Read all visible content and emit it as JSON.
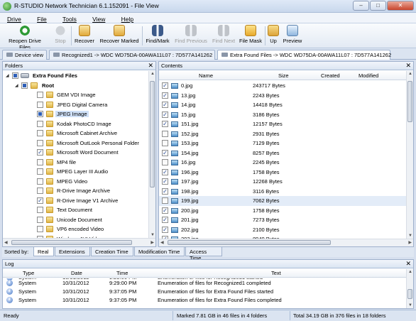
{
  "window": {
    "title": "R-STUDIO Network Technician 6.1.152091 - File View",
    "buttons": {
      "minimize": "–",
      "maximize": "□",
      "close": "✕"
    }
  },
  "menu": [
    {
      "label": "Drive",
      "underline": "D"
    },
    {
      "label": "File",
      "underline": "F"
    },
    {
      "label": "Tools",
      "underline": "T"
    },
    {
      "label": "View",
      "underline": "V"
    },
    {
      "label": "Help",
      "underline": "H"
    }
  ],
  "toolbar": [
    {
      "label": "Reopen Drive Files",
      "icon": "reopen-icon",
      "enabled": true
    },
    {
      "label": "Stop",
      "icon": "stop-icon",
      "enabled": false
    },
    {
      "label": "Recover",
      "icon": "recover-icon",
      "enabled": true
    },
    {
      "label": "Recover Marked",
      "icon": "recover-marked-icon",
      "enabled": true
    },
    {
      "label": "Find/Mark",
      "icon": "binoculars-icon",
      "enabled": true
    },
    {
      "label": "Find Previous",
      "icon": "find-previous-icon",
      "enabled": false
    },
    {
      "label": "Find Next",
      "icon": "find-next-icon",
      "enabled": false
    },
    {
      "label": "File Mask",
      "icon": "file-mask-icon",
      "enabled": true
    },
    {
      "label": "Up",
      "icon": "up-folder-icon",
      "enabled": true
    },
    {
      "label": "Preview",
      "icon": "preview-icon",
      "enabled": true
    }
  ],
  "tabs": [
    {
      "label": "Device view",
      "active": false
    },
    {
      "label": "Recognized1 -> WDC WD75DA-00AWA11L07 : 7D577A141262",
      "active": false
    },
    {
      "label": "Extra Found Files -> WDC WD75DA-00AWA11L07 : 7D577A141262",
      "active": true
    }
  ],
  "folders_panel": {
    "title": "Folders",
    "close": "✕",
    "root": "Extra Found Files",
    "subroot": "Root",
    "items": [
      {
        "label": "GEM VDI Image",
        "checked": false
      },
      {
        "label": "JPEG Digital Camera",
        "checked": false
      },
      {
        "label": "JPEG Image",
        "checked": "partial",
        "selected": true
      },
      {
        "label": "Kodak PhotoCD Image",
        "checked": false
      },
      {
        "label": "Microsoft Cabinet Archive",
        "checked": false
      },
      {
        "label": "Microsoft OutLook Personal Folder",
        "checked": false
      },
      {
        "label": "Microsoft Word Document",
        "checked": true
      },
      {
        "label": "MP4 file",
        "checked": false
      },
      {
        "label": "MPEG Layer III Audio",
        "checked": false
      },
      {
        "label": "MPEG Video",
        "checked": false
      },
      {
        "label": "R-Drive Image Archive",
        "checked": false
      },
      {
        "label": "R-Drive Image V1 Archive",
        "checked": true
      },
      {
        "label": "Text Document",
        "checked": false
      },
      {
        "label": "Unicode Document",
        "checked": false
      },
      {
        "label": "VP6 encoded Video",
        "checked": false
      },
      {
        "label": "Windows AVI Video",
        "checked": false
      },
      {
        "label": "Windows DCX File",
        "checked": false
      }
    ]
  },
  "contents_panel": {
    "title": "Contents",
    "close": "✕",
    "columns": {
      "name": "Name",
      "size": "Size",
      "created": "Created",
      "modified": "Modified"
    },
    "rows": [
      {
        "name": "0.jpg",
        "size": "243717 Bytes",
        "checked": true
      },
      {
        "name": "13.jpg",
        "size": "2243 Bytes",
        "checked": true
      },
      {
        "name": "14.jpg",
        "size": "14418 Bytes",
        "checked": true
      },
      {
        "name": "15.jpg",
        "size": "3186 Bytes",
        "checked": true
      },
      {
        "name": "151.jpg",
        "size": "12157 Bytes",
        "checked": true
      },
      {
        "name": "152.jpg",
        "size": "2931 Bytes",
        "checked": false
      },
      {
        "name": "153.jpg",
        "size": "7129 Bytes",
        "checked": false
      },
      {
        "name": "154.jpg",
        "size": "8257 Bytes",
        "checked": true
      },
      {
        "name": "16.jpg",
        "size": "2245 Bytes",
        "checked": false
      },
      {
        "name": "196.jpg",
        "size": "1758 Bytes",
        "checked": true
      },
      {
        "name": "197.jpg",
        "size": "12268 Bytes",
        "checked": true
      },
      {
        "name": "198.jpg",
        "size": "3116 Bytes",
        "checked": true
      },
      {
        "name": "199.jpg",
        "size": "7062 Bytes",
        "checked": false,
        "selected": true
      },
      {
        "name": "200.jpg",
        "size": "1758 Bytes",
        "checked": true
      },
      {
        "name": "201.jpg",
        "size": "7273 Bytes",
        "checked": true
      },
      {
        "name": "202.jpg",
        "size": "2100 Bytes",
        "checked": true
      },
      {
        "name": "203.jpg",
        "size": "8940 Bytes",
        "checked": true
      }
    ]
  },
  "sort_bar": {
    "label": "Sorted by:",
    "tabs": [
      "Real",
      "Extensions",
      "Creation Time",
      "Modification Time",
      "Access Time"
    ],
    "active": "Real"
  },
  "log_panel": {
    "title": "Log",
    "close": "✕",
    "columns": {
      "type": "Type",
      "date": "Date",
      "time": "Time",
      "text": "Text"
    },
    "rows": [
      {
        "type": "System",
        "date": "10/31/2012",
        "time": "9:29:00 PM",
        "text": "Enumeration of files for Recognized1 started"
      },
      {
        "type": "System",
        "date": "10/31/2012",
        "time": "9:29:00 PM",
        "text": "Enumeration of files for Recognized1 completed"
      },
      {
        "type": "System",
        "date": "10/31/2012",
        "time": "9:37:05 PM",
        "text": "Enumeration of files for Extra Found Files started"
      },
      {
        "type": "System",
        "date": "10/31/2012",
        "time": "9:37:05 PM",
        "text": "Enumeration of files for Extra Found Files completed"
      }
    ]
  },
  "status": {
    "left": "Ready",
    "marked": "Marked 7.81 GB in 46 files in 4 folders",
    "total": "Total 34.19 GB in 376 files in 18 folders"
  }
}
